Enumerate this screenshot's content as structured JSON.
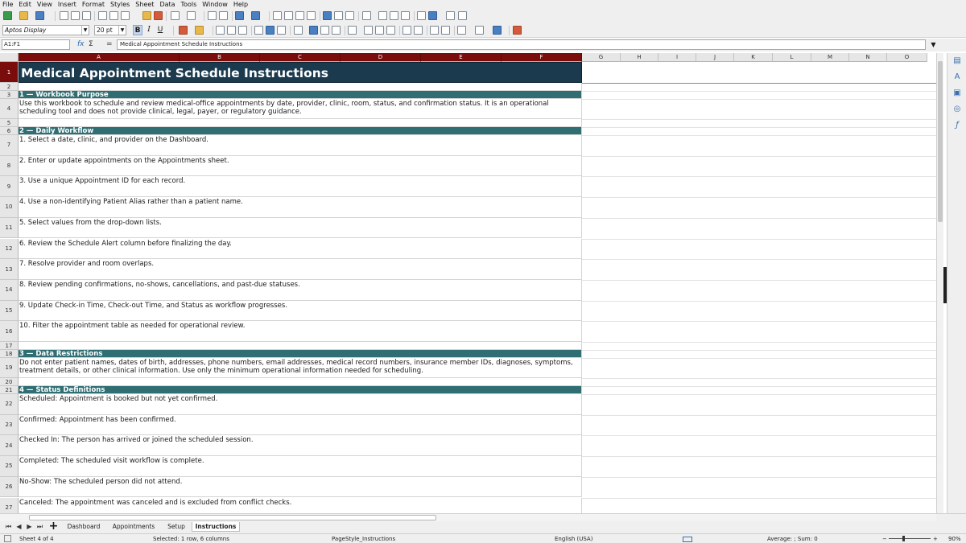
{
  "menu": [
    "File",
    "Edit",
    "View",
    "Insert",
    "Format",
    "Styles",
    "Sheet",
    "Data",
    "Tools",
    "Window",
    "Help"
  ],
  "format_toolbar": {
    "font_name": "Aptos Display",
    "font_size": "20 pt",
    "bold": "B",
    "italic": "I",
    "underline": "U"
  },
  "formula_bar": {
    "name_box": "A1:F1",
    "fx": "fx",
    "sigma": "Σ",
    "equals": "=",
    "content": "Medical Appointment Schedule Instructions"
  },
  "columns": [
    "A",
    "B",
    "C",
    "D",
    "E",
    "F",
    "G",
    "H",
    "I",
    "J",
    "K",
    "L",
    "M",
    "N",
    "O"
  ],
  "rows": [
    {
      "num": "1",
      "text": "Medical Appointment Schedule Instructions",
      "style": "title"
    },
    {
      "num": "2",
      "text": "",
      "style": "blank"
    },
    {
      "num": "3",
      "text": "1 — Workbook Purpose",
      "style": "section"
    },
    {
      "num": "4",
      "text": "Use this workbook to schedule and review medical-office appointments by date, provider, clinic, room, status, and confirmation status. It is an operational scheduling tool and does not provide clinical, legal, payer, or regulatory guidance.",
      "style": "body"
    },
    {
      "num": "5",
      "text": "",
      "style": "blank"
    },
    {
      "num": "6",
      "text": "2 — Daily Workflow",
      "style": "section"
    },
    {
      "num": "7",
      "text": "1. Select a date, clinic, and provider on the Dashboard.",
      "style": "body"
    },
    {
      "num": "8",
      "text": "2. Enter or update appointments on the Appointments sheet.",
      "style": "body"
    },
    {
      "num": "9",
      "text": "3. Use a unique Appointment ID for each record.",
      "style": "body"
    },
    {
      "num": "10",
      "text": "4. Use a non-identifying Patient Alias rather than a patient name.",
      "style": "body"
    },
    {
      "num": "11",
      "text": "5. Select values from the drop-down lists.",
      "style": "body"
    },
    {
      "num": "12",
      "text": "6. Review the Schedule Alert column before finalizing the day.",
      "style": "body"
    },
    {
      "num": "13",
      "text": "7. Resolve provider and room overlaps.",
      "style": "body"
    },
    {
      "num": "14",
      "text": "8. Review pending confirmations, no-shows, cancellations, and past-due statuses.",
      "style": "body"
    },
    {
      "num": "15",
      "text": "9. Update Check-in Time, Check-out Time, and Status as workflow progresses.",
      "style": "body"
    },
    {
      "num": "16",
      "text": "10. Filter the appointment table as needed for operational review.",
      "style": "body"
    },
    {
      "num": "17",
      "text": "",
      "style": "blank"
    },
    {
      "num": "18",
      "text": "3 — Data Restrictions",
      "style": "section"
    },
    {
      "num": "19",
      "text": "Do not enter patient names, dates of birth, addresses, phone numbers, email addresses, medical record numbers, insurance member IDs, diagnoses, symptoms, treatment details, or other clinical information. Use only the minimum operational information needed for scheduling.",
      "style": "body"
    },
    {
      "num": "20",
      "text": "",
      "style": "blank"
    },
    {
      "num": "21",
      "text": "4 — Status Definitions",
      "style": "section"
    },
    {
      "num": "22",
      "text": "Scheduled: Appointment is booked but not yet confirmed.",
      "style": "body"
    },
    {
      "num": "23",
      "text": "Confirmed: Appointment has been confirmed.",
      "style": "body"
    },
    {
      "num": "24",
      "text": "Checked In: The person has arrived or joined the scheduled session.",
      "style": "body"
    },
    {
      "num": "25",
      "text": "Completed: The scheduled visit workflow is complete.",
      "style": "body"
    },
    {
      "num": "26",
      "text": "No-Show: The scheduled person did not attend.",
      "style": "body"
    },
    {
      "num": "27",
      "text": "Canceled: The appointment was canceled and is excluded from conflict checks.",
      "style": "body"
    }
  ],
  "sheet_tabs": [
    "Dashboard",
    "Appointments",
    "Setup",
    "Instructions"
  ],
  "active_tab": "Instructions",
  "status": {
    "sheet": "Sheet 4 of 4",
    "selection": "Selected: 1 row, 6 columns",
    "page_style": "PageStyle_Instructions",
    "language": "English (USA)",
    "summary": "Average: ; Sum: 0",
    "zoom": "90%"
  }
}
